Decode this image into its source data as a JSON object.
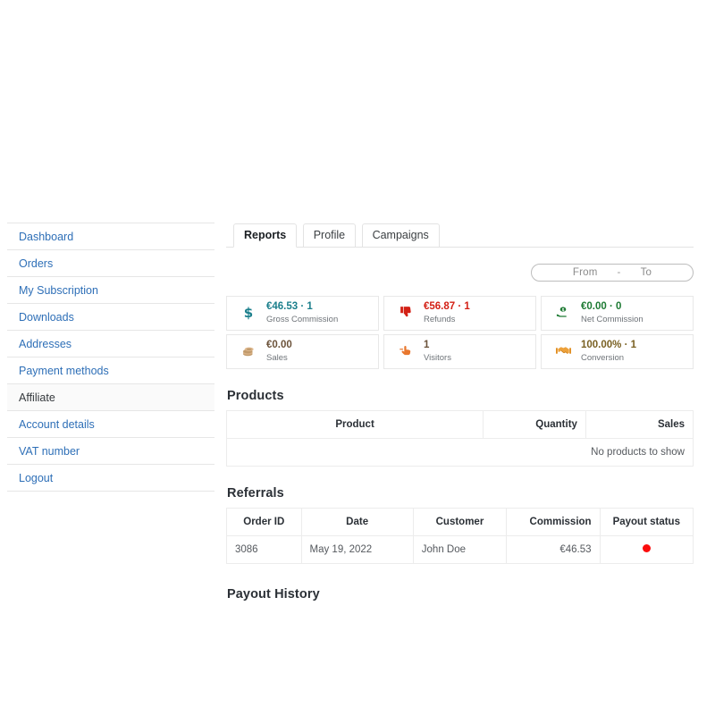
{
  "sidebar": {
    "items": [
      {
        "label": "Dashboard",
        "active": false
      },
      {
        "label": "Orders",
        "active": false
      },
      {
        "label": "My Subscription",
        "active": false
      },
      {
        "label": "Downloads",
        "active": false
      },
      {
        "label": "Addresses",
        "active": false
      },
      {
        "label": "Payment methods",
        "active": false
      },
      {
        "label": "Affiliate",
        "active": true
      },
      {
        "label": "Account details",
        "active": false
      },
      {
        "label": "VAT number",
        "active": false
      },
      {
        "label": "Logout",
        "active": false
      }
    ]
  },
  "tabs": [
    {
      "label": "Reports",
      "active": true
    },
    {
      "label": "Profile",
      "active": false
    },
    {
      "label": "Campaigns",
      "active": false
    }
  ],
  "daterange": {
    "from_placeholder": "From",
    "separator": "-",
    "to_placeholder": "To"
  },
  "stats": [
    {
      "icon": "dollar-sign-icon",
      "glyph": "$",
      "value": "€46.53 · 1",
      "label": "Gross Commission",
      "color": "#1b7f8c"
    },
    {
      "icon": "thumbs-down-icon",
      "glyph": "👎",
      "value": "€56.87 · 1",
      "label": "Refunds",
      "color": "#d32015"
    },
    {
      "icon": "money-with-hand-icon",
      "glyph": "💸",
      "value": "€0.00 · 0",
      "label": "Net Commission",
      "color": "#1d7a33"
    },
    {
      "icon": "coins-icon",
      "glyph": "🪙",
      "value": "€0.00",
      "label": "Sales",
      "color": "#6b523a"
    },
    {
      "icon": "pointing-hand-icon",
      "glyph": "👆",
      "value": "1",
      "label": "Visitors",
      "color": "#6b523a"
    },
    {
      "icon": "handshake-icon",
      "glyph": "🤝",
      "value": "100.00% · 1",
      "label": "Conversion",
      "color": "#7a6123"
    }
  ],
  "products": {
    "title": "Products",
    "columns": [
      "Product",
      "Quantity",
      "Sales"
    ],
    "empty_message": "No products to show"
  },
  "referrals": {
    "title": "Referrals",
    "columns": [
      "Order ID",
      "Date",
      "Customer",
      "Commission",
      "Payout status"
    ],
    "rows": [
      {
        "order_id": "3086",
        "date": "May 19, 2022",
        "customer": "John Doe",
        "commission": "€46.53",
        "payout_status_color": "#fb0c0c"
      }
    ]
  },
  "payout_history": {
    "title": "Payout History"
  }
}
